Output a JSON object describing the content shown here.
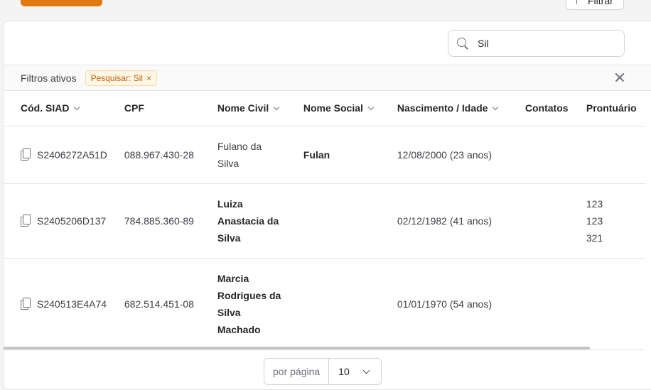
{
  "header": {
    "filter_button_label": "Filtrar"
  },
  "search": {
    "value": "Sil"
  },
  "filters": {
    "label": "Filtros ativos",
    "chips": [
      {
        "label": "Pesquisar: Sil"
      }
    ]
  },
  "table": {
    "columns": [
      "Cód. SIAD",
      "CPF",
      "Nome Civil",
      "Nome Social",
      "Nascimento / Idade",
      "Contatos",
      "Prontuário"
    ],
    "rows": [
      {
        "code": "S2406272A51D",
        "cpf": "088.967.430-28",
        "name_lines": [
          "Fulano da",
          "Silva"
        ],
        "social": "Fulan",
        "birth": "12/08/2000 (23 anos)",
        "contacts": "",
        "records": []
      },
      {
        "code": "S2405206D137",
        "cpf": "784.885.360-89",
        "name_lines": [
          "Luiza",
          "Anastacia da",
          "Silva"
        ],
        "social": "",
        "birth": "02/12/1982 (41 anos)",
        "contacts": "",
        "records": [
          "123",
          "123",
          "321"
        ]
      },
      {
        "code": "S240513E4A74",
        "cpf": "682.514.451-08",
        "name_lines": [
          "Marcia",
          "Rodrigues da",
          "Silva",
          "Machado"
        ],
        "social": "",
        "birth": "01/01/1970 (54 anos)",
        "contacts": "",
        "records": []
      }
    ]
  },
  "pagination": {
    "per_page_label": "por página",
    "per_page_value": "10"
  }
}
